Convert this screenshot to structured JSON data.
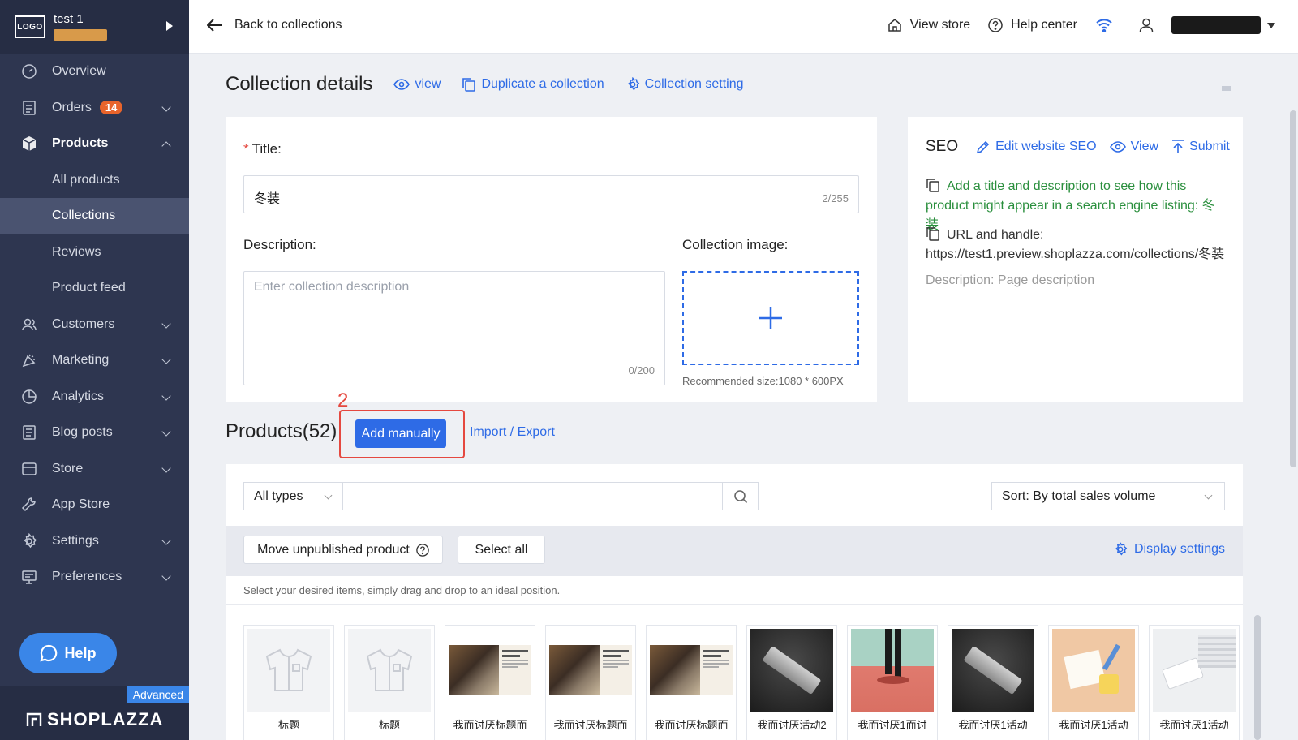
{
  "sidebar": {
    "store_name": "test 1",
    "nav": [
      {
        "label": "Overview",
        "icon": "gauge-icon"
      },
      {
        "label": "Orders",
        "icon": "orders-icon",
        "badge": "14"
      },
      {
        "label": "Products",
        "icon": "box-icon"
      },
      {
        "label": "Customers",
        "icon": "users-icon"
      },
      {
        "label": "Marketing",
        "icon": "megaphone-icon"
      },
      {
        "label": "Analytics",
        "icon": "pie-chart-icon"
      },
      {
        "label": "Blog posts",
        "icon": "document-icon"
      },
      {
        "label": "Store",
        "icon": "store-icon"
      },
      {
        "label": "App Store",
        "icon": "wrench-icon"
      },
      {
        "label": "Settings",
        "icon": "gear-icon"
      },
      {
        "label": "Preferences",
        "icon": "monitor-icon"
      }
    ],
    "product_sub": [
      "All products",
      "Collections",
      "Reviews",
      "Product feed"
    ],
    "help_label": "Help",
    "plan_tag": "Advanced",
    "brand_wordmark": "SHOPLAZZA"
  },
  "topbar": {
    "back_label": "Back to collections",
    "view_store": "View store",
    "help_center": "Help center"
  },
  "page": {
    "title": "Collection details",
    "view_link": "view",
    "duplicate_link": "Duplicate a collection",
    "setting_link": "Collection setting"
  },
  "form": {
    "title_label": "Title",
    "title_suffix": ":",
    "title_value": "冬装",
    "title_counter": "2/255",
    "description_label": "Description:",
    "description_placeholder": "Enter collection description",
    "description_counter": "0/200",
    "image_label": "Collection image:",
    "image_hint": "Recommended size:1080 * 600PX"
  },
  "seo": {
    "title": "SEO",
    "edit": "Edit website SEO",
    "view": "View",
    "submit": "Submit",
    "hint": "Add a title and description to see how this product might appear in a search engine listing: 冬装",
    "url": "URL and handle: https://test1.preview.shoplazza.com/collections/冬装",
    "description": "Description: Page description"
  },
  "products": {
    "title": "Products(52)",
    "annotation": "2",
    "add_manually": "Add manually",
    "import_export": "Import / Export",
    "type_filter": "All types",
    "sort": "Sort: By total sales volume",
    "move_unpublished": "Move unpublished product",
    "select_all": "Select all",
    "display_settings": "Display settings",
    "drag_hint": "Select your desired items, simply drag and drop to an ideal position.",
    "items": [
      {
        "name": "标题",
        "kind": "placeholder"
      },
      {
        "name": "标题",
        "kind": "placeholder"
      },
      {
        "name": "我而讨厌标题而",
        "kind": "flannel"
      },
      {
        "name": "我而讨厌标题而",
        "kind": "flannel"
      },
      {
        "name": "我而讨厌标题而",
        "kind": "flannel"
      },
      {
        "name": "我而讨厌活动2",
        "kind": "hub-dark"
      },
      {
        "name": "我而讨厌1而讨",
        "kind": "legs"
      },
      {
        "name": "我而讨厌1活动",
        "kind": "hub-dark"
      },
      {
        "name": "我而讨厌1活动",
        "kind": "desk"
      },
      {
        "name": "我而讨厌1活动",
        "kind": "hub-white"
      }
    ]
  }
}
